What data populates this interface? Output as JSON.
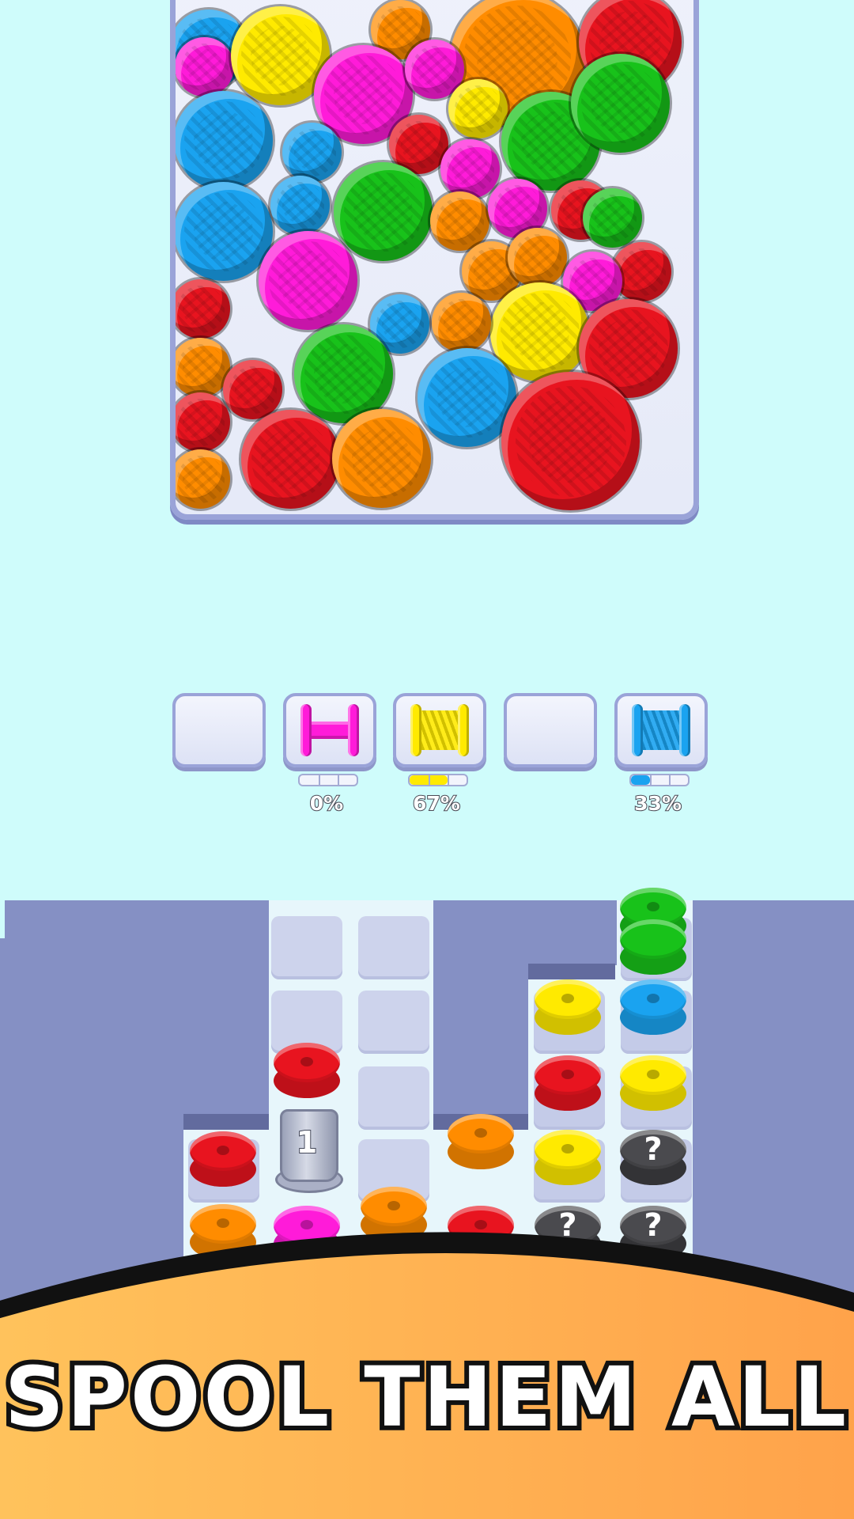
{
  "jar": {
    "balls": [
      {
        "color": "#1aa3f0"
      },
      {
        "color": "#ff1bd9"
      },
      {
        "color": "#ffea00"
      },
      {
        "color": "#ff8c00"
      },
      {
        "color": "#ff8c00"
      },
      {
        "color": "#e8141f"
      },
      {
        "color": "#ff1bd9"
      },
      {
        "color": "#ff1bd9"
      },
      {
        "color": "#1aa3f0"
      },
      {
        "color": "#1aa3f0"
      },
      {
        "color": "#e8141f"
      },
      {
        "color": "#ffea00"
      },
      {
        "color": "#18c21a"
      },
      {
        "color": "#18c21a"
      },
      {
        "color": "#1aa3f0"
      },
      {
        "color": "#1aa3f0"
      },
      {
        "color": "#18c21a"
      },
      {
        "color": "#ff1bd9"
      },
      {
        "color": "#ff8c00"
      },
      {
        "color": "#ff1bd9"
      },
      {
        "color": "#e8141f"
      },
      {
        "color": "#18c21a"
      },
      {
        "color": "#ff1bd9"
      },
      {
        "color": "#ff8c00"
      },
      {
        "color": "#ff8c00"
      },
      {
        "color": "#e8141f"
      },
      {
        "color": "#ff1bd9"
      },
      {
        "color": "#e8141f"
      },
      {
        "color": "#1aa3f0"
      },
      {
        "color": "#ff8c00"
      },
      {
        "color": "#ffea00"
      },
      {
        "color": "#e8141f"
      },
      {
        "color": "#ff8c00"
      },
      {
        "color": "#18c21a"
      },
      {
        "color": "#e8141f"
      },
      {
        "color": "#1aa3f0"
      },
      {
        "color": "#e8141f"
      },
      {
        "color": "#e8141f"
      },
      {
        "color": "#ff8c00"
      },
      {
        "color": "#e8141f"
      },
      {
        "color": "#ff8c00"
      }
    ]
  },
  "slots": [
    {
      "spool_color": "",
      "progress": null,
      "label": ""
    },
    {
      "spool_color": "#ff1bd9",
      "progress": 0,
      "label": "0%"
    },
    {
      "spool_color": "#ffea00",
      "progress": 0.67,
      "label": "67%"
    },
    {
      "spool_color": "",
      "progress": null,
      "label": ""
    },
    {
      "spool_color": "#1aa3f0",
      "progress": 0.33,
      "label": "33%"
    }
  ],
  "board": {
    "locker_count": "1",
    "mystery_symbol": "?",
    "discs": [
      {
        "color": "#e8141f"
      },
      {
        "color": "#ff8c00"
      },
      {
        "color": "#ff1bd9"
      },
      {
        "color": "#ff8c00"
      },
      {
        "color": "#e8141f"
      },
      {
        "color": "#ff8c00"
      },
      {
        "color": "#e8141f"
      },
      {
        "color": "#ffea00"
      },
      {
        "color": "#e8141f"
      },
      {
        "color": "#ffea00"
      },
      {
        "color": "#18c21a"
      },
      {
        "color": "#1aa3f0"
      },
      {
        "color": "#ffea00"
      },
      {
        "color": "mystery"
      },
      {
        "color": "mystery"
      },
      {
        "color": "mystery"
      }
    ]
  },
  "banner": {
    "title": "SPOOL THEM ALL",
    "gradient_start": "#ffc35c",
    "gradient_end": "#ffa24a"
  }
}
